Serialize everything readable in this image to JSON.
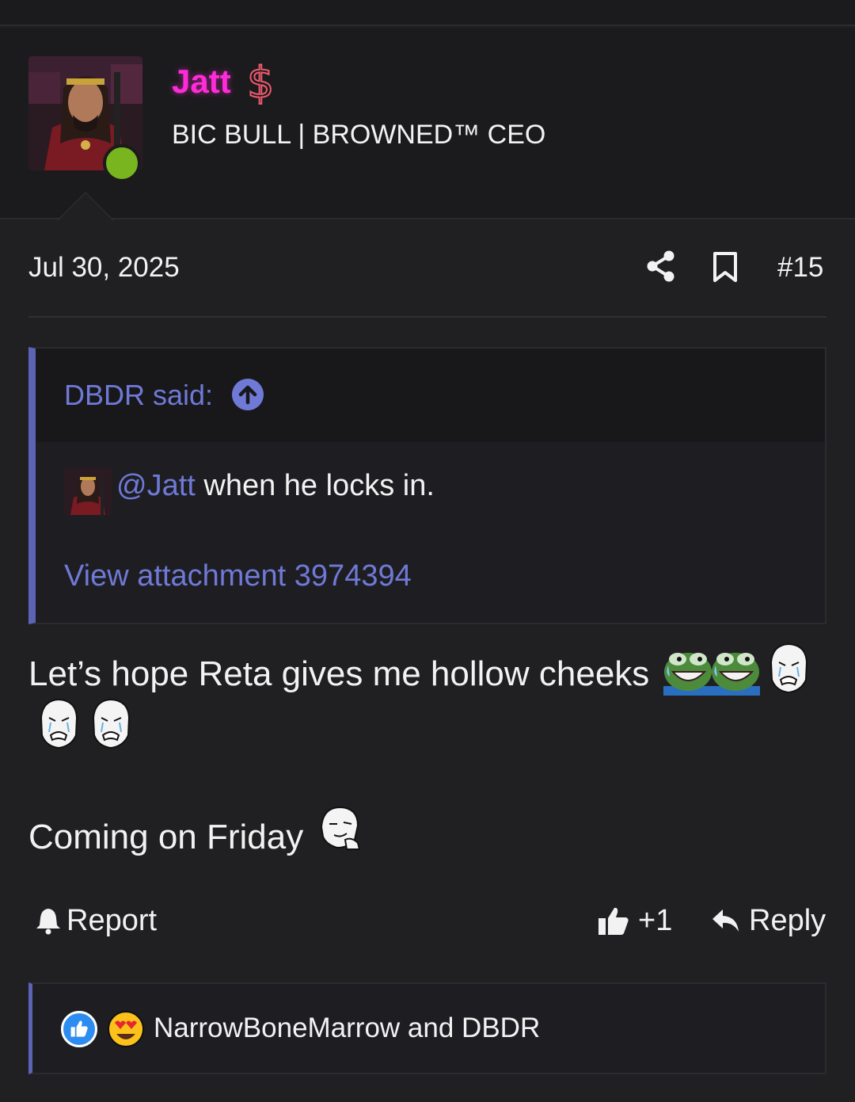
{
  "user": {
    "name": "Jatt",
    "title": "BIC BULL | BROWNED™ CEO",
    "badge_icon": "dollar-sign-icon",
    "online": true,
    "name_color": "#ff2bd8"
  },
  "post": {
    "date": "Jul 30, 2025",
    "number": "#15",
    "quote": {
      "author": "DBDR said:",
      "mention": "@Jatt",
      "text": " when he locks in.",
      "attachment": "View attachment 3974394"
    },
    "body_line1": "Let’s hope Reta gives me hollow cheeks",
    "body_line2": "Coming on Friday"
  },
  "actions": {
    "report": "Report",
    "like": "+1",
    "reply": "Reply"
  },
  "reactions": {
    "users": "NarrowBoneMarrow and DBDR"
  },
  "colors": {
    "accent": "#6f79d6",
    "quote_bar": "#5c63b5",
    "background": "#202022",
    "online": "#78b51f"
  }
}
